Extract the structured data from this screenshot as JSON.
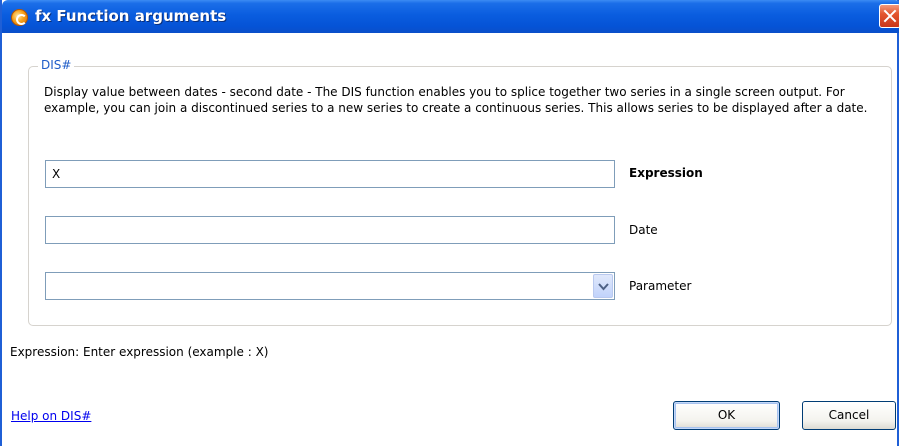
{
  "window": {
    "title": "fx Function arguments",
    "title_icon": "app-logo-icon",
    "close_icon": "close-icon"
  },
  "group": {
    "legend": "DIS#",
    "description": "Display value between dates - second date - The DIS function enables you to splice together two series in a single screen output. For example, you can join a discontinued series to a new series to create a continuous series. This allows series to be displayed after a date."
  },
  "fields": {
    "expression": {
      "value": "X",
      "label": "Expression"
    },
    "date": {
      "value": "",
      "label": "Date"
    },
    "parameter": {
      "value": "",
      "label": "Parameter"
    }
  },
  "hint": "Expression: Enter expression (example : X)",
  "help_link": "Help on DIS#",
  "buttons": {
    "ok": "OK",
    "cancel": "Cancel"
  },
  "colors": {
    "titlebar": "#0553d6",
    "legend": "#1e5cc8",
    "link": "#0000ee",
    "close": "#e3562f"
  }
}
